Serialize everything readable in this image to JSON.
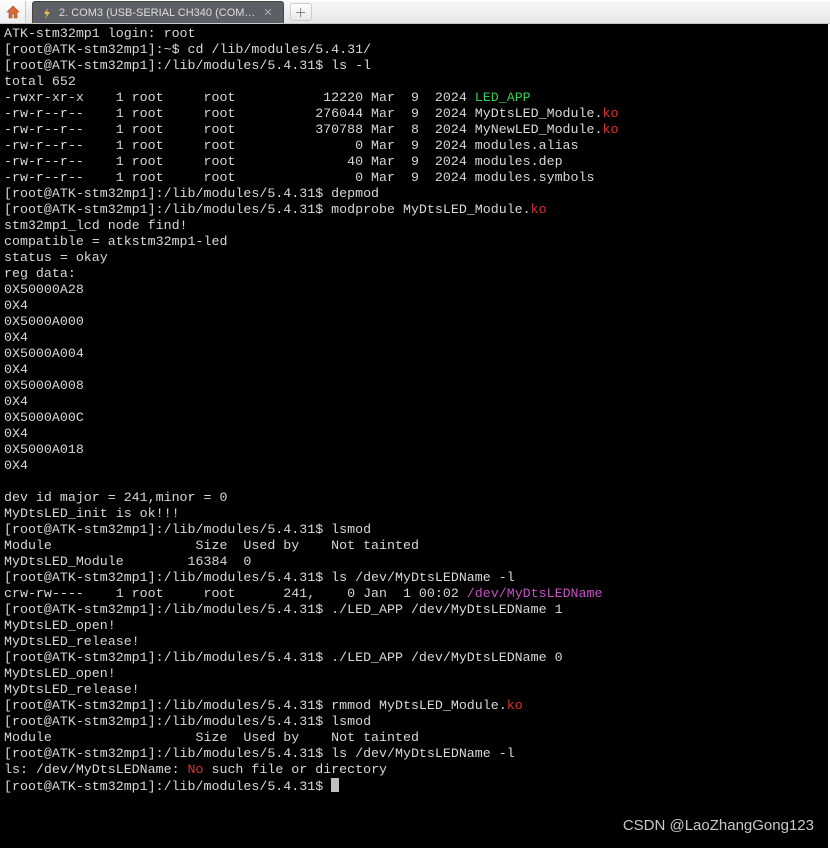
{
  "tab_title": "2. COM3 (USB-SERIAL CH340 (COM…",
  "watermark": "CSDN @LaoZhangGong123",
  "prompt": {
    "host": "ATK-stm32mp1",
    "user": "root",
    "login_line": "ATK-stm32mp1 login: root",
    "home_prompt": "[root@ATK-stm32mp1]:~$ ",
    "dir_prompt": "[root@ATK-stm32mp1]:/lib/modules/5.4.31$ "
  },
  "cmds": {
    "cd": "cd /lib/modules/5.4.31/",
    "ls_l": "ls -l",
    "depmod": "depmod",
    "modprobe": "modprobe MyDtsLED_Module.",
    "lsmod": "lsmod",
    "ls_dev": "ls /dev/MyDtsLEDName -l",
    "led1": "./LED_APP /dev/MyDtsLEDName 1",
    "led0": "./LED_APP /dev/MyDtsLEDName 0",
    "rmmod": "rmmod MyDtsLED_Module.",
    "ko": "ko"
  },
  "ls": {
    "total": "total 652",
    "rows": [
      {
        "perm": "-rwxr-xr-x",
        "ln": "1",
        "u": "root",
        "g": "root",
        "sz": "12220",
        "date": "Mar  9  2024",
        "name": "LED_APP",
        "cls": "green"
      },
      {
        "perm": "-rw-r--r--",
        "ln": "1",
        "u": "root",
        "g": "root",
        "sz": "276044",
        "date": "Mar  9  2024",
        "name": "MyDtsLED_Module.",
        "suffix": "ko",
        "cls": ""
      },
      {
        "perm": "-rw-r--r--",
        "ln": "1",
        "u": "root",
        "g": "root",
        "sz": "370788",
        "date": "Mar  8  2024",
        "name": "MyNewLED_Module.",
        "suffix": "ko",
        "cls": ""
      },
      {
        "perm": "-rw-r--r--",
        "ln": "1",
        "u": "root",
        "g": "root",
        "sz": "0",
        "date": "Mar  9  2024",
        "name": "modules.alias",
        "cls": ""
      },
      {
        "perm": "-rw-r--r--",
        "ln": "1",
        "u": "root",
        "g": "root",
        "sz": "40",
        "date": "Mar  9  2024",
        "name": "modules.dep",
        "cls": ""
      },
      {
        "perm": "-rw-r--r--",
        "ln": "1",
        "u": "root",
        "g": "root",
        "sz": "0",
        "date": "Mar  9  2024",
        "name": "modules.symbols",
        "cls": ""
      }
    ]
  },
  "modprobe_out": [
    "stm32mp1_lcd node find!",
    "compatible = atkstm32mp1-led",
    "status = okay",
    "reg data:",
    "0X50000A28",
    "0X4",
    "0X5000A000",
    "0X4",
    "0X5000A004",
    "0X4",
    "0X5000A008",
    "0X4",
    "0X5000A00C",
    "0X4",
    "0X5000A018",
    "0X4",
    "",
    "dev id major = 241,minor = 0",
    "MyDtsLED_init is ok!!!"
  ],
  "lsmod_out": {
    "hdr": "Module                  Size  Used by    Not tainted",
    "row": "MyDtsLED_Module        16384  0"
  },
  "dev_ls": {
    "perm": "crw-rw----",
    "ln": "1",
    "u": "root",
    "g": "root",
    "maj": "241,",
    "min": "0",
    "date": "Jan  1 00:02",
    "path": "/dev/MyDtsLEDName"
  },
  "open_rel": [
    "MyDtsLED_open!",
    "MyDtsLED_release!"
  ],
  "ls_err": {
    "pre": "ls: /dev/MyDtsLEDName: ",
    "no": "No",
    "post": " such file or directory"
  }
}
